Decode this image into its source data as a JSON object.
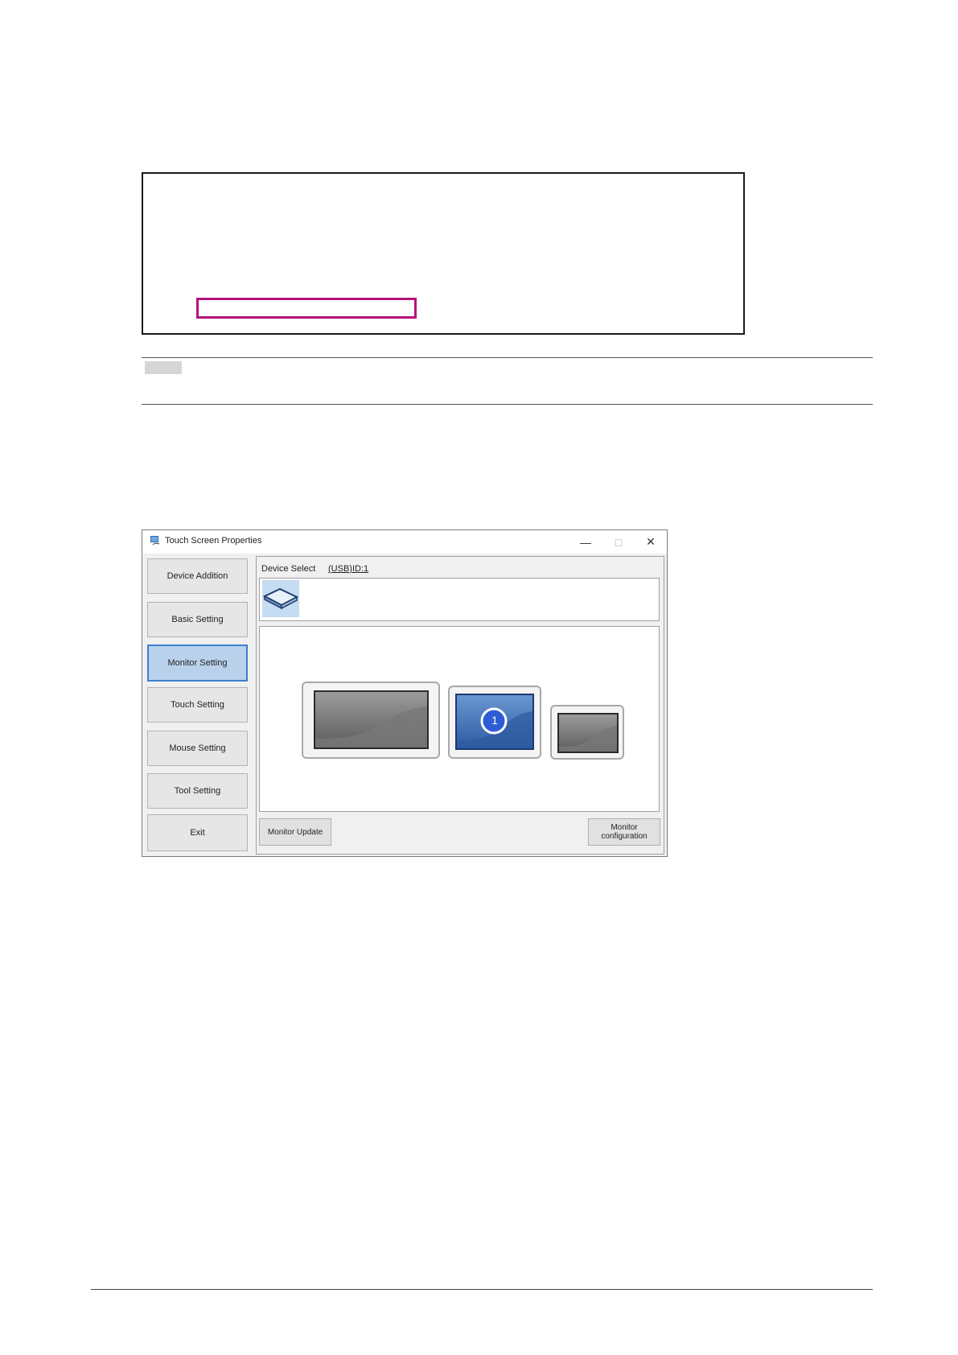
{
  "window": {
    "title": "Touch Screen Properties",
    "controls": {
      "minimize": "—",
      "maximize": "□",
      "close": "✕"
    }
  },
  "sidebar": {
    "items": [
      {
        "label": "Device Addition"
      },
      {
        "label": "Basic Setting"
      },
      {
        "label": "Monitor Setting",
        "active": true
      },
      {
        "label": "Touch Setting"
      },
      {
        "label": "Mouse Setting"
      },
      {
        "label": "Tool Setting"
      },
      {
        "label": "Exit"
      }
    ]
  },
  "device_select": {
    "label": "Device Select",
    "device_id": "(USB)ID:1"
  },
  "monitors": [
    {
      "selected": false
    },
    {
      "selected": true,
      "number": "1"
    },
    {
      "selected": false
    }
  ],
  "buttons": {
    "monitor_update": "Monitor Update",
    "monitor_configuration_line1": "Monitor",
    "monitor_configuration_line2": "configuration"
  },
  "colors": {
    "highlight_box": "#b5137a",
    "active_sidebar": "#b9d1ea",
    "selected_monitor": "#2f5ea6"
  }
}
